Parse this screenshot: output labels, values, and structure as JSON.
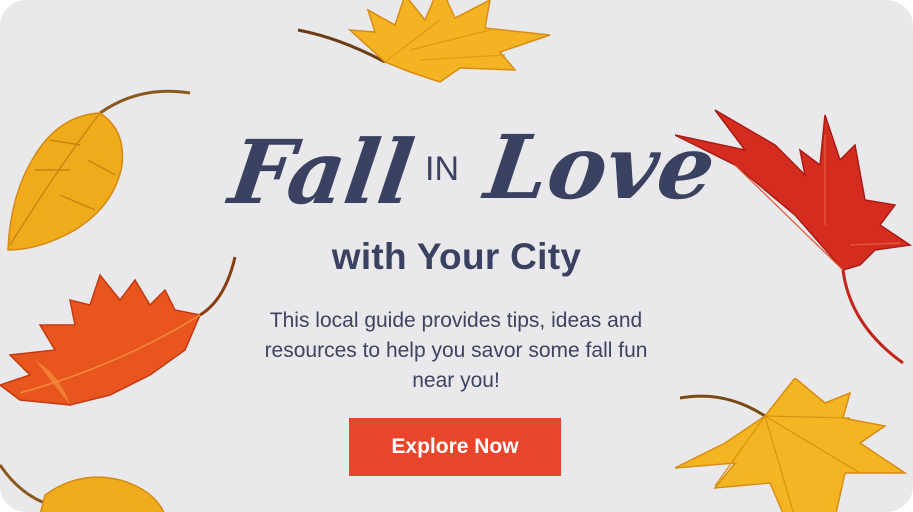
{
  "headline": {
    "fall": "Fall",
    "in": "IN",
    "love": "Love",
    "subtitle": "with Your City"
  },
  "description": "This local guide provides tips, ideas and resources to help you savor some fall fun near you!",
  "cta": {
    "label": "Explore Now"
  },
  "colors": {
    "background": "#e9e9eb",
    "text": "#3b4261",
    "button": "#e8452a",
    "leaf_yellow": "#f2b21e",
    "leaf_orange": "#e8611f",
    "leaf_red": "#d42a1e"
  }
}
